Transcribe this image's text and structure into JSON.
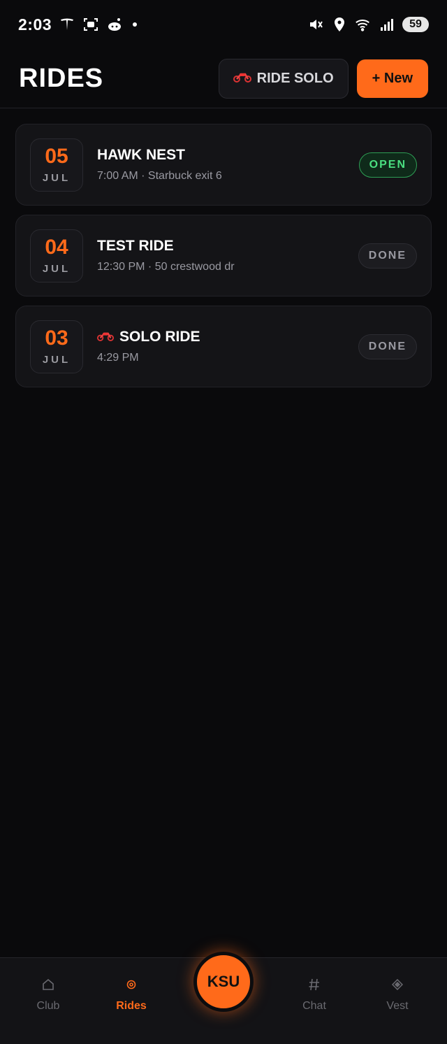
{
  "status_bar": {
    "time": "2:03",
    "battery": "59",
    "icons": [
      "tesla-icon",
      "face-scan-icon",
      "reddit-icon",
      "mute-icon",
      "location-icon",
      "wifi-icon",
      "signal-icon"
    ]
  },
  "header": {
    "title": "RIDES",
    "solo_button": {
      "icon": "motorcycle-icon",
      "label": "RIDE SOLO"
    },
    "new_button": {
      "label": "+ New"
    }
  },
  "rides": [
    {
      "day": "05",
      "month": "JUL",
      "title": "HAWK NEST",
      "has_icon": false,
      "subtitle": "7:00 AM · Starbuck exit 6",
      "status": "OPEN"
    },
    {
      "day": "04",
      "month": "JUL",
      "title": "TEST RIDE",
      "has_icon": false,
      "subtitle": "12:30 PM · 50 crestwood  dr",
      "status": "DONE"
    },
    {
      "day": "03",
      "month": "JUL",
      "title": "SOLO RIDE",
      "has_icon": true,
      "icon": "motorcycle-icon",
      "subtitle": "4:29 PM",
      "status": "DONE"
    }
  ],
  "nav": {
    "items": [
      {
        "label": "Club",
        "icon": "home-icon",
        "active": false
      },
      {
        "label": "Rides",
        "icon": "target-icon",
        "active": true
      },
      {
        "label": "Chat",
        "icon": "hash-icon",
        "active": false
      },
      {
        "label": "Vest",
        "icon": "diamond-icon",
        "active": false
      }
    ],
    "fab_label": "KSU"
  },
  "colors": {
    "accent": "#ff6a1a",
    "background": "#0a0a0c",
    "open": "#4ade80"
  }
}
